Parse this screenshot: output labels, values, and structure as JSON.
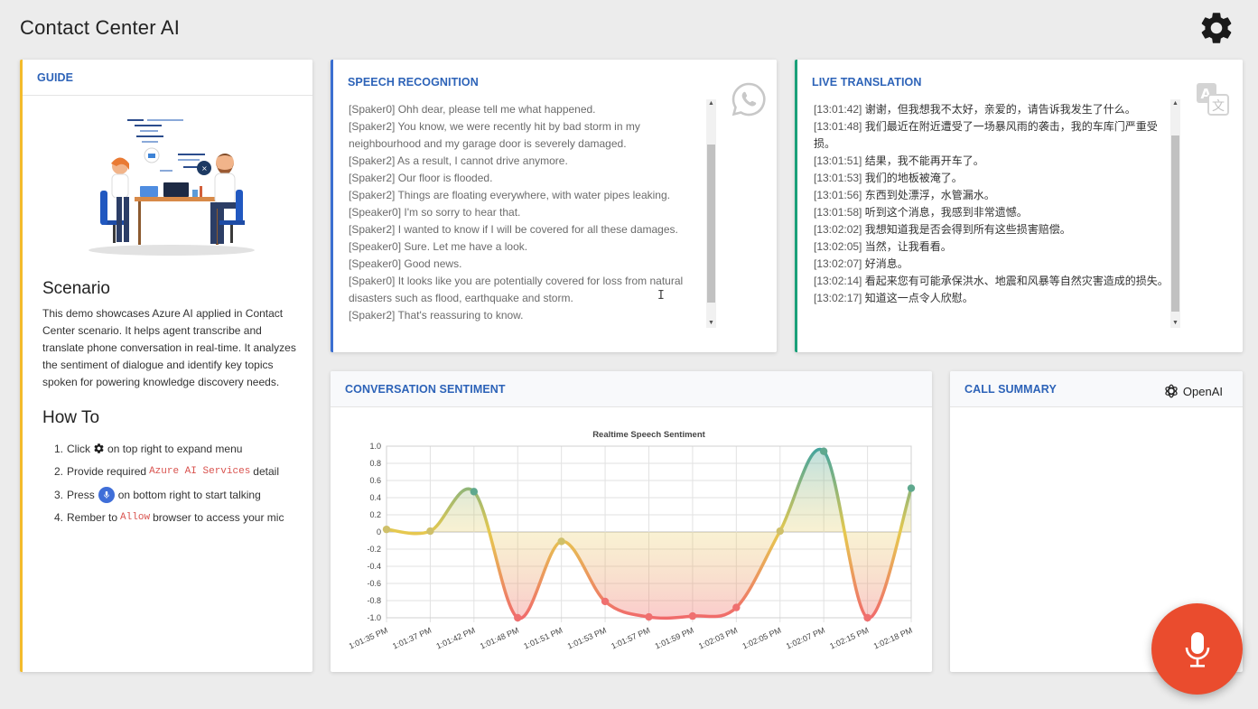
{
  "app": {
    "title": "Contact Center AI",
    "settings_icon": "gear-icon"
  },
  "guide": {
    "title": "GUIDE",
    "scenario_heading": "Scenario",
    "scenario_text": "This demo showcases Azure AI applied in Contact Center scenario. It helps agent transcribe and translate phone conversation in real-time. It analyzes the sentiment of dialogue and identify key topics spoken for powering knowledge discovery needs.",
    "howto_heading": "How To",
    "steps": [
      {
        "num": "1.",
        "before": "Click",
        "code": "",
        "after": "on top right to expand menu",
        "icon": "gear-icon"
      },
      {
        "num": "2.",
        "before": "Provide required",
        "code": "Azure AI Services",
        "after": "detail",
        "icon": ""
      },
      {
        "num": "3.",
        "before": "Press",
        "code": "",
        "after": "on bottom right to start talking",
        "icon": "microphone-icon"
      },
      {
        "num": "4.",
        "before": "Rember to",
        "code": "Allow",
        "after": "browser to access your mic",
        "icon": ""
      }
    ]
  },
  "speech": {
    "title": "SPEECH RECOGNITION",
    "icon": "whatsapp-icon",
    "lines": [
      "[Spaker0] Ohh dear, please tell me what happened.",
      "[Spaker2] You know, we were recently hit by bad storm in my neighbourhood and my garage door is severely damaged.",
      "[Spaker2] As a result, I cannot drive anymore.",
      "[Spaker2] Our floor is flooded.",
      "[Spaker2] Things are floating everywhere, with water pipes leaking.",
      "[Speaker0] I'm so sorry to hear that.",
      "[Spaker2] I wanted to know if I will be covered for all these damages.",
      "[Speaker0] Sure. Let me have a look.",
      "[Speaker0] Good news.",
      "[Spaker0] It looks like you are potentially covered for loss from natural disasters such as flood, earthquake and storm.",
      "[Spaker2] That's reassuring to know."
    ]
  },
  "translation": {
    "title": "LIVE TRANSLATION",
    "icon": "translate-icon",
    "lines": [
      {
        "time": "[13:01:42]",
        "text": "谢谢，但我想我不太好，亲爱的，请告诉我发生了什么。"
      },
      {
        "time": "[13:01:48]",
        "text": "我们最近在附近遭受了一场暴风雨的袭击，我的车库门严重受损。"
      },
      {
        "time": "[13:01:51]",
        "text": "结果，我不能再开车了。"
      },
      {
        "time": "[13:01:53]",
        "text": "我们的地板被淹了。"
      },
      {
        "time": "[13:01:56]",
        "text": "东西到处漂浮，水管漏水。"
      },
      {
        "time": "[13:01:58]",
        "text": "听到这个消息，我感到非常遗憾。"
      },
      {
        "time": "[13:02:02]",
        "text": "我想知道我是否会得到所有这些损害赔偿。"
      },
      {
        "time": "[13:02:05]",
        "text": "当然，让我看看。"
      },
      {
        "time": "[13:02:07]",
        "text": "好消息。"
      },
      {
        "time": "[13:02:14]",
        "text": "看起来您有可能承保洪水、地震和风暴等自然灾害造成的损失。"
      },
      {
        "time": "[13:02:17]",
        "text": "知道这一点令人欣慰。"
      }
    ]
  },
  "sentiment": {
    "title": "CONVERSATION SENTIMENT"
  },
  "summary": {
    "title": "CALL SUMMARY",
    "brand": "OpenAI",
    "brand_icon": "openai-logo-icon"
  },
  "mic_button": {
    "icon": "microphone-icon",
    "color": "#ea4c2e"
  },
  "colors": {
    "guide_accent": "#f3bb2c",
    "speech_accent": "#3b6fd1",
    "translation_accent": "#1aa079",
    "title_blue": "#2d63b8"
  },
  "chart_data": {
    "type": "line",
    "title": "Realtime Speech Sentiment",
    "x": [
      "1:01:35 PM",
      "1:01:37 PM",
      "1:01:42 PM",
      "1:01:48 PM",
      "1:01:51 PM",
      "1:01:53 PM",
      "1:01:57 PM",
      "1:01:59 PM",
      "1:02:03 PM",
      "1:02:05 PM",
      "1:02:07 PM",
      "1:02:15 PM",
      "1:02:18 PM"
    ],
    "values": [
      0.03,
      0.01,
      0.47,
      -1.0,
      -0.11,
      -0.81,
      -0.99,
      -0.98,
      -0.88,
      0.01,
      0.94,
      -1.0,
      0.51
    ],
    "ylim": [
      -1.0,
      1.0
    ],
    "yticks": [
      "1.0",
      "0.8",
      "0.6",
      "0.4",
      "0.2",
      "0",
      "-0.2",
      "-0.4",
      "-0.6",
      "-0.8",
      "-1.0"
    ],
    "grid": true,
    "line_colors": {
      "positive": "#3fa3a0",
      "neutral": "#e6c94f",
      "negative": "#f06b6b"
    }
  }
}
